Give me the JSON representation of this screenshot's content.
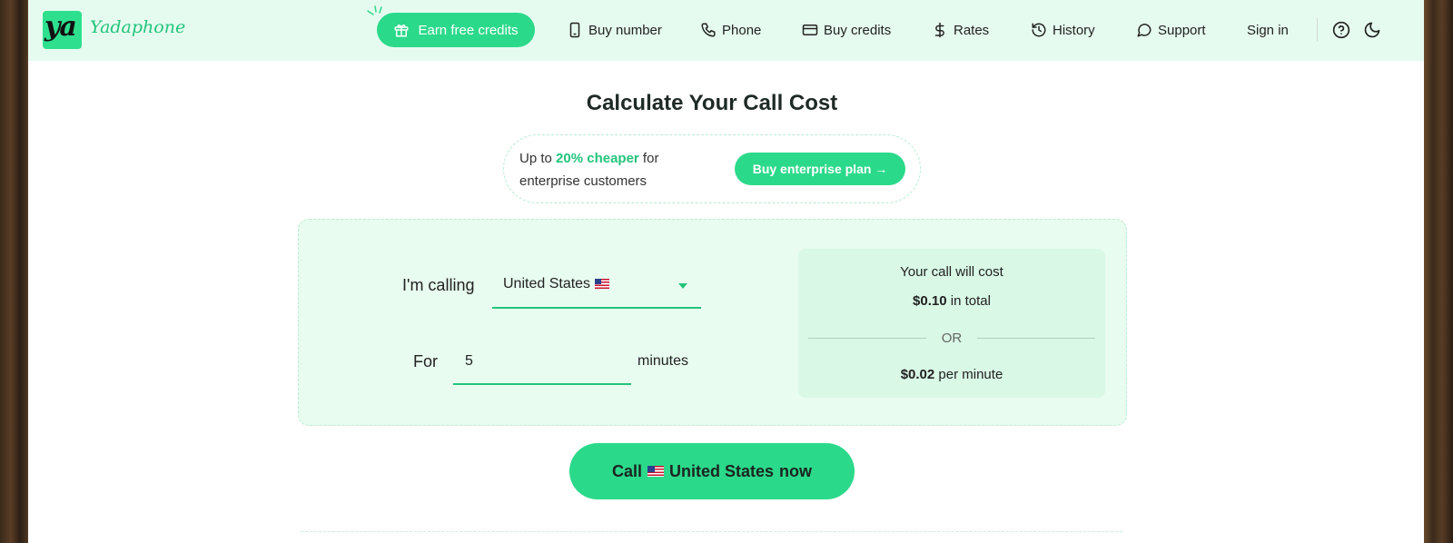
{
  "brand": {
    "logo_mark": "ya",
    "name": "Yadaphone"
  },
  "nav": {
    "earn_label": "Earn free credits",
    "items": [
      {
        "label": "Buy number",
        "icon": "phone-device-icon"
      },
      {
        "label": "Phone",
        "icon": "phone-handset-icon"
      },
      {
        "label": "Buy credits",
        "icon": "credit-card-icon"
      },
      {
        "label": "Rates",
        "icon": "dollar-icon"
      },
      {
        "label": "History",
        "icon": "history-icon"
      },
      {
        "label": "Support",
        "icon": "chat-bubble-icon"
      }
    ],
    "signin_label": "Sign in"
  },
  "page_title": "Calculate Your Call Cost",
  "promo": {
    "prefix": "Up to ",
    "highlight": "20% cheaper",
    "suffix": " for enterprise customers",
    "button_label": "Buy enterprise plan →"
  },
  "calculator": {
    "calling_label": "I'm calling",
    "country": "United States",
    "for_label": "For",
    "minutes_value": "5",
    "minutes_label": "minutes"
  },
  "result": {
    "heading": "Your call will cost",
    "total_amount": "$0.10",
    "total_suffix": " in total",
    "or_label": "OR",
    "per_minute_amount": "$0.02",
    "per_minute_suffix": " per minute"
  },
  "call_button": {
    "prefix": "Call",
    "country": "United States",
    "suffix": "now"
  },
  "colors": {
    "accent": "#2bd98a",
    "accent_text": "#22c47c",
    "header_bg": "#e6fbef",
    "panel_bg": "#e8fcf0"
  }
}
